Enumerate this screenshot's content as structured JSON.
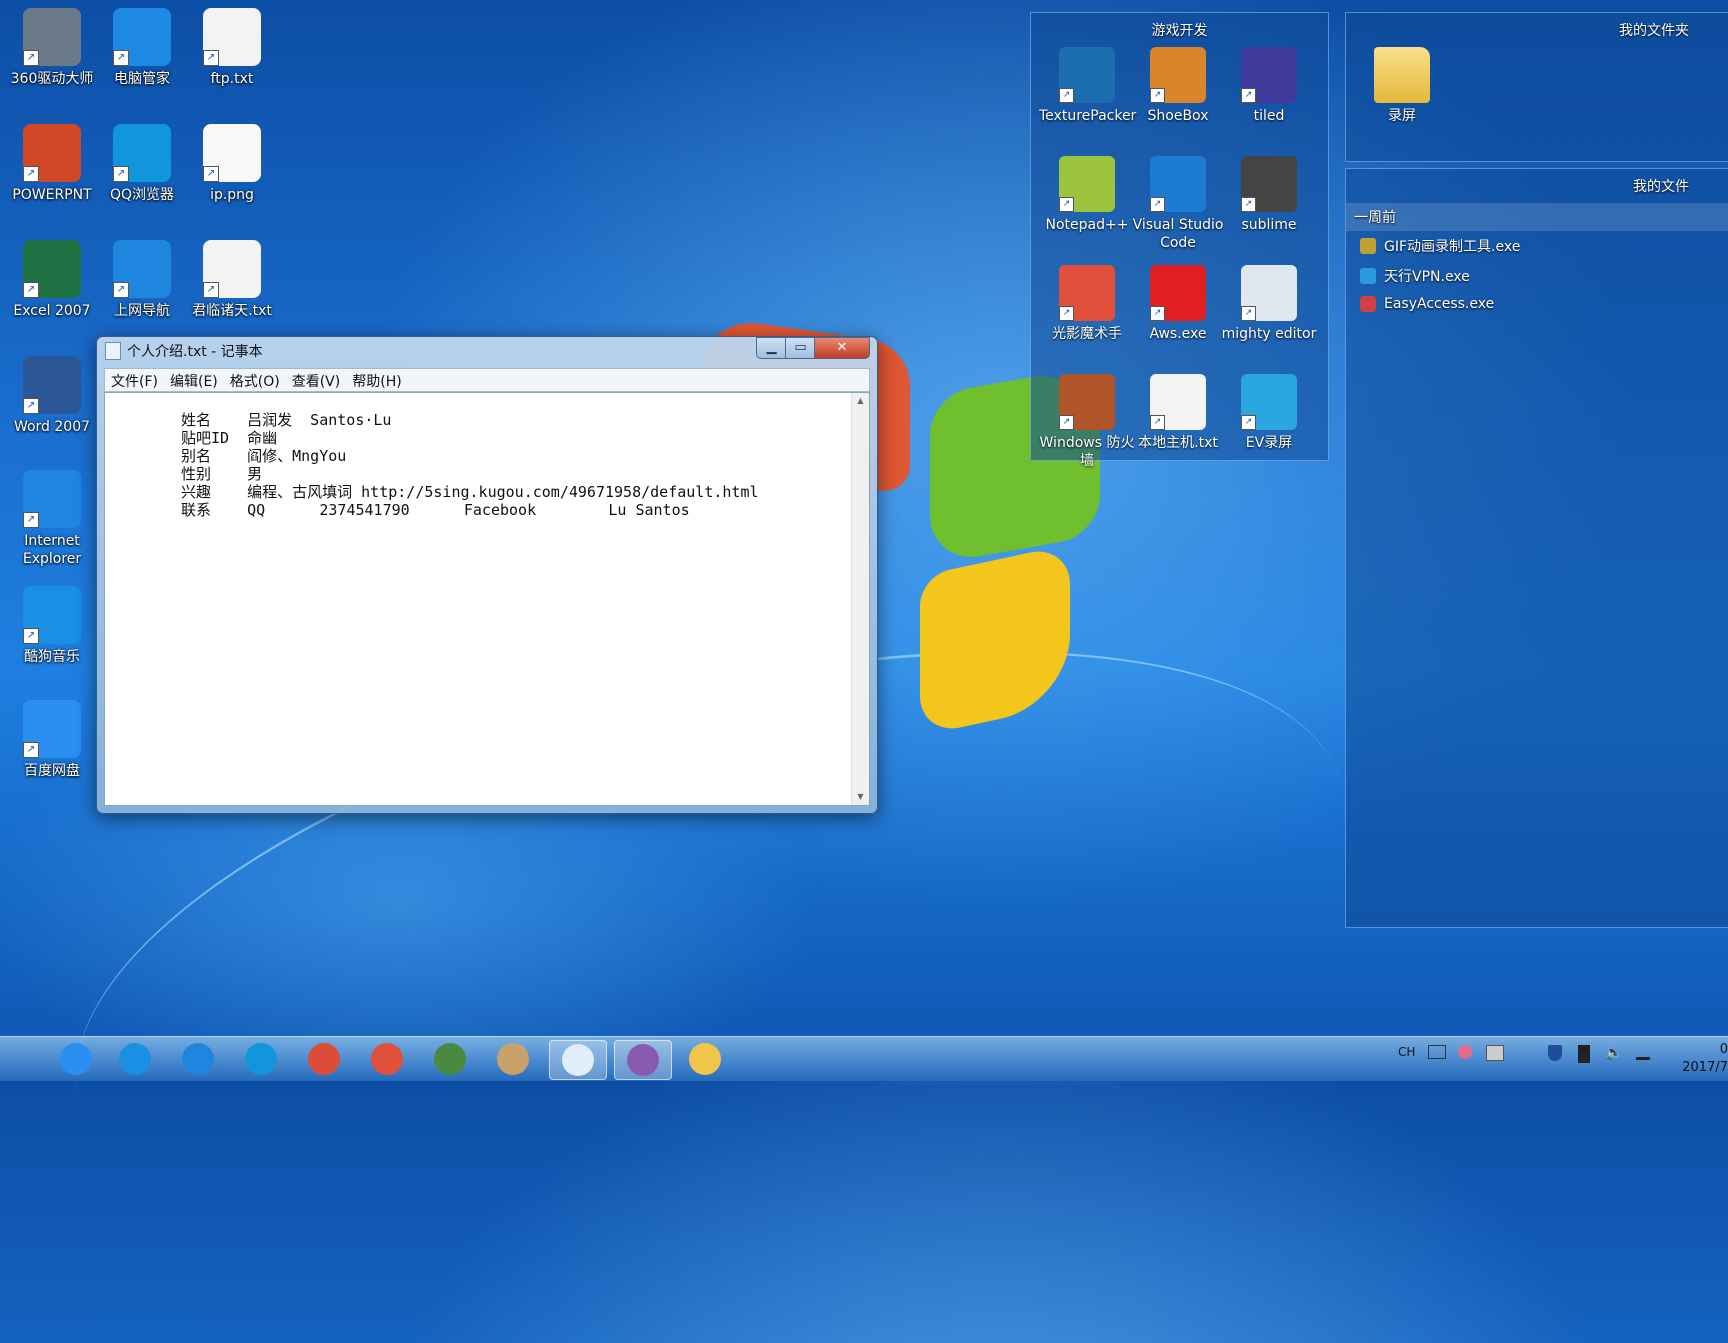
{
  "desktop": {
    "icons": [
      {
        "label": "360驱动大师",
        "color": "#6b7a88",
        "icon": "gear-icon"
      },
      {
        "label": "电脑管家",
        "color": "#1e88e5",
        "icon": "shield-icon"
      },
      {
        "label": "ftp.txt",
        "color": "#f3f3f3",
        "icon": "text-file-icon"
      },
      {
        "label": "POWERPNT",
        "color": "#d24726",
        "icon": "powerpoint-icon"
      },
      {
        "label": "QQ浏览器",
        "color": "#1296db",
        "icon": "browser-icon"
      },
      {
        "label": "ip.png",
        "color": "#f8f8f8",
        "icon": "image-file-icon"
      },
      {
        "label": "Excel 2007",
        "color": "#207245",
        "icon": "excel-icon"
      },
      {
        "label": "上网导航",
        "color": "#1f86e0",
        "icon": "ie-icon"
      },
      {
        "label": "君临诸天.txt",
        "color": "#f3f3f3",
        "icon": "text-file-icon"
      },
      {
        "label": "Word 2007",
        "color": "#2b5797",
        "icon": "word-icon"
      },
      {
        "label": "Internet Explorer",
        "color": "#1f86e0",
        "icon": "ie-icon"
      },
      {
        "label": "酷狗音乐",
        "color": "#1a8fe3",
        "icon": "kugou-icon"
      },
      {
        "label": "百度网盘",
        "color": "#2a8ff0",
        "icon": "cloud-icon"
      }
    ]
  },
  "game_panel": {
    "title": "游戏开发",
    "icons": [
      {
        "label": "TexturePacker",
        "color": "#1b6fb0",
        "icon": "texturepacker-icon"
      },
      {
        "label": "ShoeBox",
        "color": "#d9852a",
        "icon": "shoebox-icon"
      },
      {
        "label": "tiled",
        "color": "#3d3a9c",
        "icon": "tiled-icon"
      },
      {
        "label": "Notepad++",
        "color": "#9bc33b",
        "icon": "notepadpp-icon"
      },
      {
        "label": "Visual Studio Code",
        "color": "#1e7bd4",
        "icon": "vscode-icon"
      },
      {
        "label": "sublime",
        "color": "#444444",
        "icon": "sublime-icon"
      },
      {
        "label": "光影魔术手",
        "color": "#e0503a",
        "icon": "color-wheel-icon"
      },
      {
        "label": "Aws.exe",
        "color": "#e02020",
        "icon": "aws-icon"
      },
      {
        "label": "mighty editor",
        "color": "#dfe7ef",
        "icon": "gear-icon"
      },
      {
        "label": "Windows 防火墙",
        "color": "#b0542a",
        "icon": "firewall-icon"
      },
      {
        "label": "本地主机.txt",
        "color": "#f3f3f3",
        "icon": "text-file-icon"
      },
      {
        "label": "EV录屏",
        "color": "#2aa6e0",
        "icon": "ev-icon"
      }
    ]
  },
  "folder_panel": {
    "title": "我的文件夹",
    "folder_label": "录屏"
  },
  "files_panel": {
    "title": "我的文件",
    "group": "一周前",
    "files": [
      {
        "label": "GIF动画录制工具.exe",
        "color": "#c0a030"
      },
      {
        "label": "天行VPN.exe",
        "color": "#2a9ae0"
      },
      {
        "label": "EasyAccess.exe",
        "color": "#d04040"
      }
    ]
  },
  "notepad": {
    "title": "个人介绍.txt - 记事本",
    "menu": [
      "文件(F)",
      "编辑(E)",
      "格式(O)",
      "查看(V)",
      "帮助(H)"
    ],
    "lines": [
      "姓名    吕润发  Santos·Lu",
      "贴吧ID  命幽",
      "别名    阎修、MngYou",
      "性别    男",
      "兴趣    编程、古风填词 http://5sing.kugou.com/49671958/default.html",
      "联系    QQ      2374541790      Facebook        Lu Santos"
    ]
  },
  "taskbar": {
    "apps": [
      {
        "icon": "baidu-cloud-icon",
        "color": "#2a8ff0"
      },
      {
        "icon": "kugou-icon",
        "color": "#1a8fe3"
      },
      {
        "icon": "ie-icon",
        "color": "#1f86e0"
      },
      {
        "icon": "qq-browser-icon",
        "color": "#1296db"
      },
      {
        "icon": "chrome-icon",
        "color": "#dd4b39"
      },
      {
        "icon": "color-wheel-icon",
        "color": "#e0503a"
      },
      {
        "icon": "game-icon",
        "color": "#4a8a40"
      },
      {
        "icon": "paint-icon",
        "color": "#c9a26a"
      },
      {
        "icon": "notepad-icon",
        "color": "#dfeef8"
      },
      {
        "icon": "character-icon",
        "color": "#8a5ab0"
      },
      {
        "icon": "explorer-icon",
        "color": "#f1c44a"
      }
    ],
    "tray_lang": "CH",
    "clock_time": "0",
    "clock_date": "2017/7"
  }
}
